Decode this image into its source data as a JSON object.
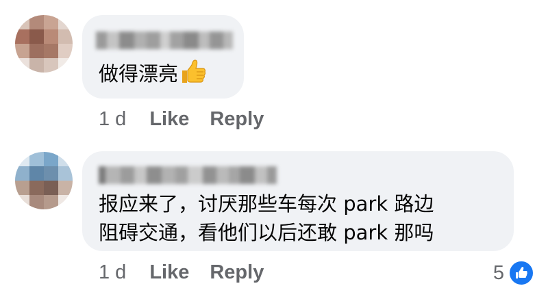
{
  "comments": [
    {
      "text_lines": [
        "做得漂亮"
      ],
      "emoji": "thumbs-up-icon",
      "time": "1 d",
      "like_label": "Like",
      "reply_label": "Reply"
    },
    {
      "text_lines": [
        "报应来了，讨厌那些车每次 park 路边",
        "阻碍交通，看他们以后还敢 park 那吗"
      ],
      "time": "1 d",
      "like_label": "Like",
      "reply_label": "Reply",
      "reaction_count": "5"
    }
  ],
  "colors": {
    "bubble": "#f0f2f5",
    "secondary_text": "#65676b",
    "like_blue": "#1877f2"
  }
}
